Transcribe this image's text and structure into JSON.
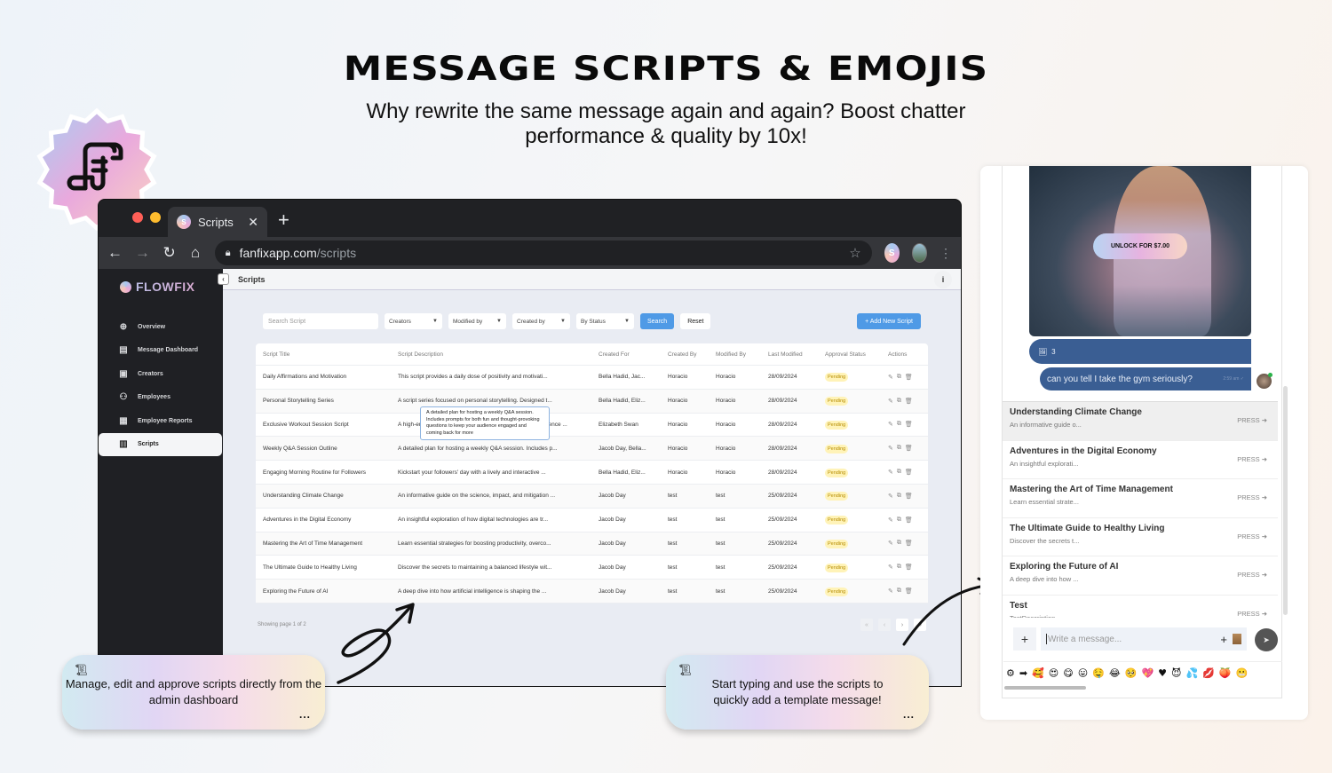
{
  "hero": {
    "title": "MESSAGE SCRIPTS & EMOJIS",
    "subtitle": "Why rewrite the same message again and again? Boost chatter performance & quality by 10x!"
  },
  "browser": {
    "tab_title": "Scripts",
    "tab_close": "✕",
    "new_tab": "+",
    "url_host": "fanfixapp.com",
    "url_path": "/scripts",
    "extension_label": "S"
  },
  "app": {
    "brand": "FLOWFIX",
    "breadcrumb": "Scripts",
    "sidebar": {
      "items": [
        {
          "label": "Overview",
          "icon": "globe-icon",
          "glyph": "⊕"
        },
        {
          "label": "Message Dashboard",
          "icon": "message-icon",
          "glyph": "▤"
        },
        {
          "label": "Creators",
          "icon": "creator-icon",
          "glyph": "▣"
        },
        {
          "label": "Employees",
          "icon": "employees-icon",
          "glyph": "⚇"
        },
        {
          "label": "Employee Reports",
          "icon": "report-icon",
          "glyph": "▦"
        },
        {
          "label": "Scripts",
          "icon": "scroll-icon",
          "glyph": "▥",
          "active": true
        }
      ]
    },
    "filters": {
      "search_placeholder": "Search Script",
      "creators": "Creators",
      "modified_by": "Modified by",
      "created_by": "Created by",
      "status": "By Status",
      "search_button": "Search",
      "reset_button": "Reset",
      "add_button": "+ Add New Script"
    },
    "table": {
      "columns": [
        "Script Title",
        "Script Description",
        "Created For",
        "Created By",
        "Modified By",
        "Last Modified",
        "Approval Status",
        "Actions"
      ],
      "rows": [
        {
          "title": "Daily Affirmations and Motivation",
          "description": "This script provides a daily dose of positivity and motivati...",
          "created_for": "Bella Hadid, Jac...",
          "created_by": "Horacio",
          "modified_by": "Horacio",
          "last_modified": "28/09/2024",
          "status": "Pending"
        },
        {
          "title": "Personal Storytelling Series",
          "description": "A script series focused on personal storytelling. Designed t...",
          "created_for": "Bella Hadid, Eliz...",
          "created_by": "Horacio",
          "modified_by": "Horacio",
          "last_modified": "28/09/2024",
          "status": "Pending"
        },
        {
          "title": "Exclusive Workout Session Script",
          "description": "A high-energy workout script designed to engage your audience ...",
          "created_for": "Elizabeth Swan",
          "created_by": "Horacio",
          "modified_by": "Horacio",
          "last_modified": "28/09/2024",
          "status": "Pending"
        },
        {
          "title": "Weekly Q&A Session Outline",
          "description": "A detailed plan for hosting a weekly Q&A session. Includes p...",
          "created_for": "Jacob Day, Bella...",
          "created_by": "Horacio",
          "modified_by": "Horacio",
          "last_modified": "28/09/2024",
          "status": "Pending"
        },
        {
          "title": "Engaging Morning Routine for Followers",
          "description": "Kickstart your followers' day with a lively and interactive ...",
          "created_for": "Bella Hadid, Eliz...",
          "created_by": "Horacio",
          "modified_by": "Horacio",
          "last_modified": "28/09/2024",
          "status": "Pending"
        },
        {
          "title": "Understanding Climate Change",
          "description": "An informative guide on the science, impact, and mitigation ...",
          "created_for": "Jacob Day",
          "created_by": "test",
          "modified_by": "test",
          "last_modified": "25/09/2024",
          "status": "Pending"
        },
        {
          "title": "Adventures in the Digital Economy",
          "description": "An insightful exploration of how digital technologies are tr...",
          "created_for": "Jacob Day",
          "created_by": "test",
          "modified_by": "test",
          "last_modified": "25/09/2024",
          "status": "Pending"
        },
        {
          "title": "Mastering the Art of Time Management",
          "description": "Learn essential strategies for boosting productivity, overco...",
          "created_for": "Jacob Day",
          "created_by": "test",
          "modified_by": "test",
          "last_modified": "25/09/2024",
          "status": "Pending"
        },
        {
          "title": "The Ultimate Guide to Healthy Living",
          "description": "Discover the secrets to maintaining a balanced lifestyle wit...",
          "created_for": "Jacob Day",
          "created_by": "test",
          "modified_by": "test",
          "last_modified": "25/09/2024",
          "status": "Pending"
        },
        {
          "title": "Exploring the Future of AI",
          "description": "A deep dive into how artificial intelligence is shaping the ...",
          "created_for": "Jacob Day",
          "created_by": "test",
          "modified_by": "test",
          "last_modified": "25/09/2024",
          "status": "Pending"
        }
      ],
      "tooltip": "A detailed plan for hosting a weekly Q&A session. Includes prompts for both fun and thought-provoking questions to keep your audience engaged and coming back for more"
    },
    "pagination": {
      "summary": "Showing page 1 of 2",
      "first": "«",
      "prev": "‹",
      "next": "›",
      "last": "»"
    }
  },
  "callouts": {
    "left": {
      "text": "Manage, edit and approve scripts directly from the admin dashboard",
      "more": "..."
    },
    "right": {
      "text": "Start typing and use the scripts to quickly add a template message!",
      "more": "..."
    }
  },
  "chat": {
    "unlock_label": "UNLOCK FOR $7.00",
    "media_count": "3",
    "message": "can you tell I take the gym seriously?",
    "message_time": "2:59 am ✓",
    "scripts": [
      {
        "title": "Understanding Climate Change",
        "desc": "An informative guide o...",
        "action": "PRESS ➜"
      },
      {
        "title": "Adventures in the Digital Economy",
        "desc": "An insightful explorati...",
        "action": "PRESS ➜"
      },
      {
        "title": "Mastering the Art of Time Management",
        "desc": "Learn essential strate...",
        "action": "PRESS ➜"
      },
      {
        "title": "The Ultimate Guide to Healthy Living",
        "desc": "Discover the secrets t...",
        "action": "PRESS ➜"
      },
      {
        "title": "Exploring the Future of AI",
        "desc": "A deep dive into how ...",
        "action": "PRESS ➜"
      },
      {
        "title": "Test",
        "desc": "TestDescription",
        "action": "PRESS ➜"
      }
    ],
    "input_placeholder": "Write a message...",
    "emojis": [
      "⚙",
      "➡",
      "🥰",
      "😍",
      "😋",
      "😛",
      "🤤",
      "😂",
      "🥺",
      "💖",
      "♥",
      "😈",
      "💦",
      "💋",
      "🍑",
      "😬"
    ]
  },
  "colors": {
    "primary": "#4f9ae6",
    "pending_bg": "#fff3b8",
    "chat_bubble": "#3a5e93",
    "sidebar_bg": "#1f2024"
  }
}
